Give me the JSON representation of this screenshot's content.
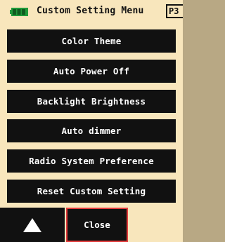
{
  "header": {
    "title": "Custom Setting Menu",
    "page": "P3",
    "battery_icon": "battery-icon",
    "battery_color": "#1f9a3a"
  },
  "menu": {
    "items": [
      {
        "label": "Color Theme"
      },
      {
        "label": "Auto Power Off"
      },
      {
        "label": "Backlight Brightness"
      },
      {
        "label": "Auto dimmer"
      },
      {
        "label": "Radio System Preference"
      },
      {
        "label": "Reset Custom Setting"
      }
    ]
  },
  "footer": {
    "up_icon": "triangle-up-icon",
    "close_label": "Close",
    "close_border_color": "#e23b3b"
  },
  "colors": {
    "background": "#f8e6bc",
    "button": "#111111",
    "button_text": "#ffffff"
  }
}
